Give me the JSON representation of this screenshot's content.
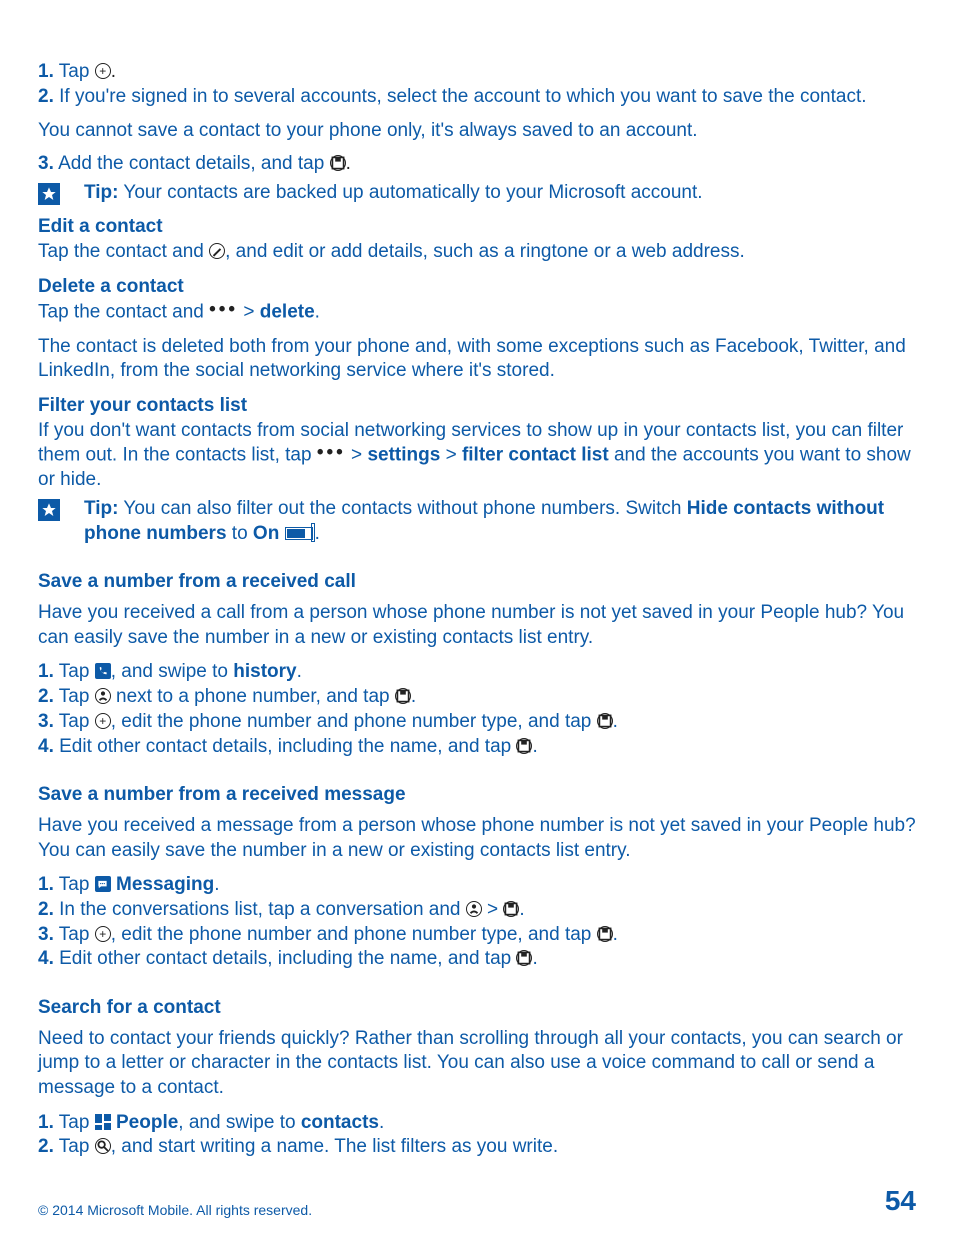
{
  "s1": {
    "n1": "1.",
    "t1a": " Tap ",
    "n2": "2.",
    "t2": " If you're signed in to several accounts, select the account to which you want to save the contact.",
    "t3": "You cannot save a contact to your phone only, it's always saved to an account.",
    "n3": "3.",
    "t3a": " Add the contact details, and tap ",
    "tiplabel": "Tip:",
    "tiptext": " Your contacts are backed up automatically to your Microsoft account."
  },
  "edit": {
    "h": "Edit a contact",
    "t1": "Tap the contact and ",
    "t2": ", and edit or add details, such as a ringtone or a web address."
  },
  "del": {
    "h": "Delete a contact",
    "t1": "Tap the contact and  ",
    "gt": "  > ",
    "del": "delete",
    "t2": "The contact is deleted both from your phone and, with some exceptions such as Facebook, Twitter, and LinkedIn, from the social networking service where it's stored."
  },
  "filter": {
    "h": "Filter your contacts list",
    "t1": "If you don't want contacts from social networking services to show up in your contacts list, you can filter them out. In the contacts list, tap  ",
    "gt": "  > ",
    "settings": "settings",
    "gt2": " > ",
    "fcl": "filter contact list",
    "t2": " and the accounts you want to show or hide.",
    "tiplabel": "Tip:",
    "tiptext1": " You can also filter out the contacts without phone numbers. Switch ",
    "hidelabel": "Hide contacts without phone numbers",
    "to": " to ",
    "on": "On"
  },
  "savecall": {
    "h": "Save a number from a received call",
    "intro": "Have you received a call from a person whose phone number is not yet saved in your People hub? You can easily save the number in a new or existing contacts list entry.",
    "n1": "1.",
    "t1a": " Tap ",
    "t1b": ", and swipe to ",
    "hist": "history",
    "n2": "2.",
    "t2a": " Tap ",
    "t2b": " next to a phone number, and tap ",
    "n3": "3.",
    "t3a": " Tap ",
    "t3b": ", edit the phone number and phone number type, and tap ",
    "n4": "4.",
    "t4": " Edit other contact details, including the name, and tap "
  },
  "savemsg": {
    "h": "Save a number from a received message",
    "intro": "Have you received a message from a person whose phone number is not yet saved in your People hub? You can easily save the number in a new or existing contacts list entry.",
    "n1": "1.",
    "t1a": " Tap ",
    "msg": " Messaging",
    "n2": "2.",
    "t2a": " In the conversations list, tap a conversation and ",
    "gt": " > ",
    "n3": "3.",
    "t3a": " Tap ",
    "t3b": ", edit the phone number and phone number type, and tap ",
    "n4": "4.",
    "t4": " Edit other contact details, including the name, and tap "
  },
  "search": {
    "h": "Search for a contact",
    "intro": "Need to contact your friends quickly? Rather than scrolling through all your contacts, you can search or jump to a letter or character in the contacts list. You can also use a voice command to call or send a message to a contact.",
    "n1": "1.",
    "t1a": " Tap ",
    "people": " People",
    "t1b": ", and swipe to ",
    "contacts": "contacts",
    "n2": "2.",
    "t2a": " Tap ",
    "t2b": ", and start writing a name. The list filters as you write."
  },
  "footer": {
    "copy": "© 2014 Microsoft Mobile. All rights reserved.",
    "page": "54"
  }
}
